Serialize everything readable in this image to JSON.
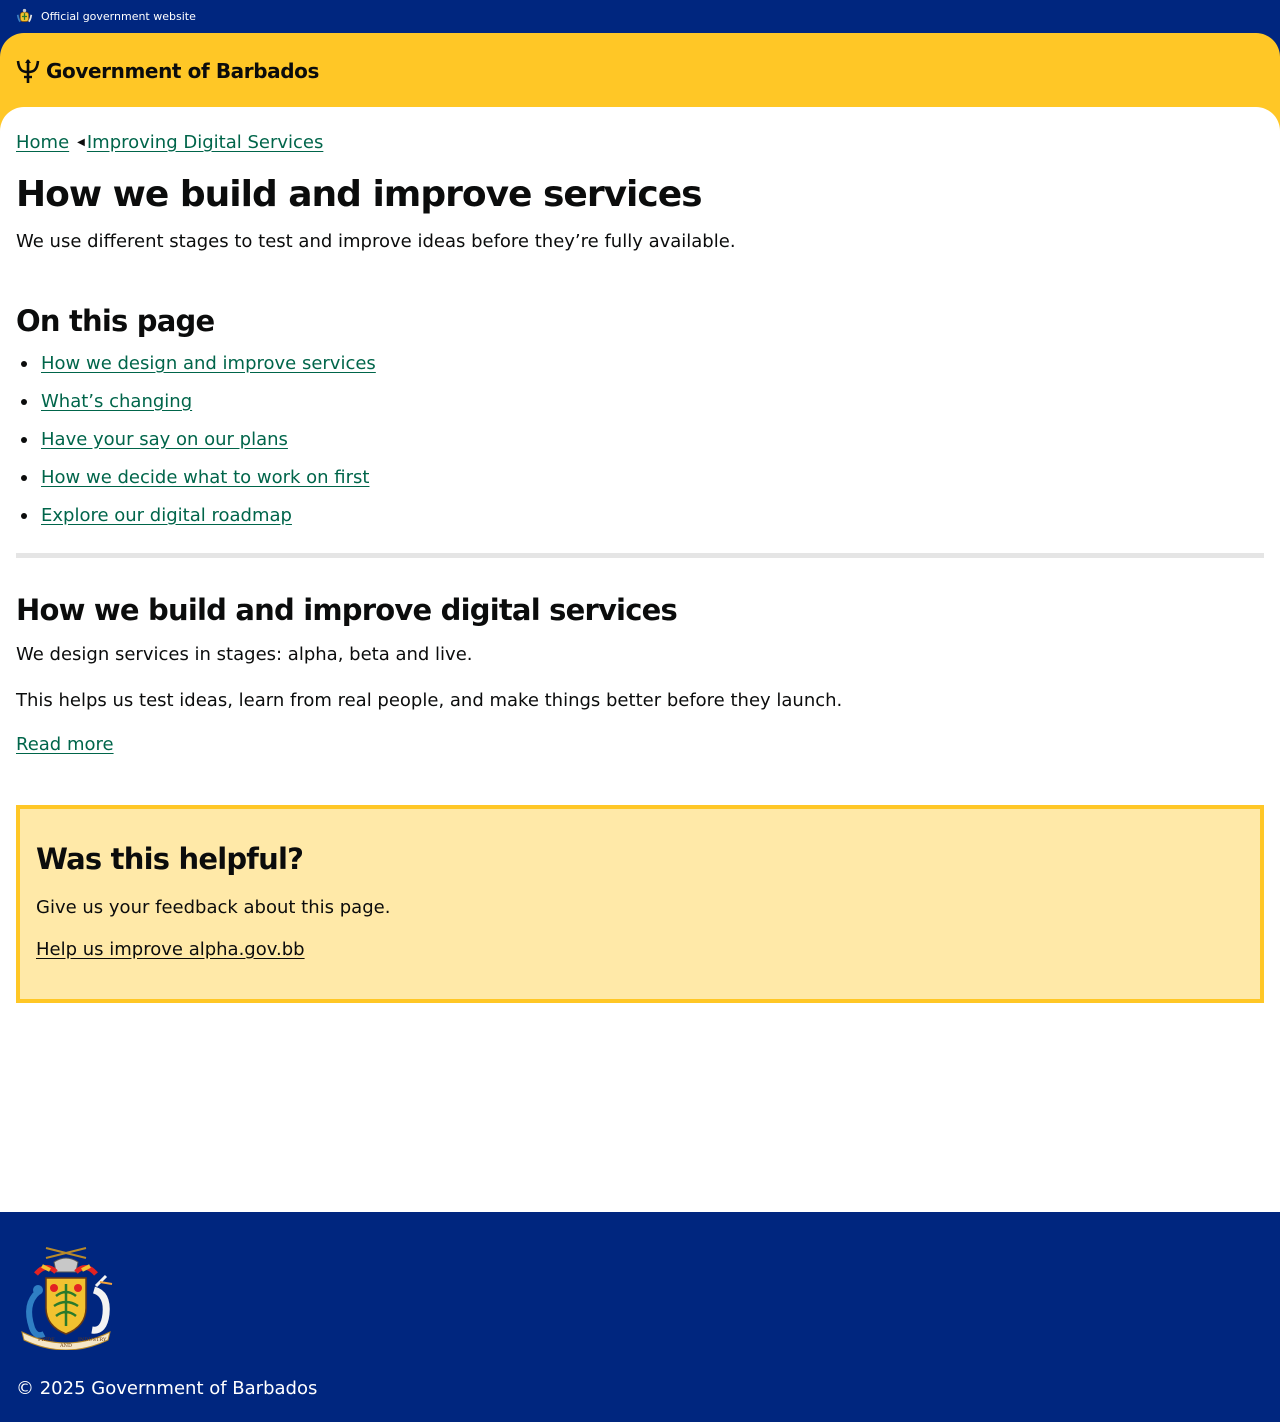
{
  "topbar": {
    "official_text": "Official government website",
    "crest_icon": "coat-of-arms-icon"
  },
  "header": {
    "brand_name": "Government of Barbados",
    "brand_icon": "trident-icon",
    "colors": {
      "banner": "#ffc726",
      "topbar": "#00267f"
    }
  },
  "breadcrumb": {
    "items": [
      {
        "label": "Home"
      },
      {
        "label": "Improving Digital Services"
      }
    ],
    "separator_icon": "arrow-left-icon"
  },
  "page": {
    "title": "How we build and improve services",
    "lead": "We use different stages to test and improve ideas before they’re fully available."
  },
  "toc": {
    "title": "On this page",
    "items": [
      {
        "label": "How we design and improve services"
      },
      {
        "label": "What’s changing"
      },
      {
        "label": "Have your say on our plans"
      },
      {
        "label": "How we decide what to work on first"
      },
      {
        "label": "Explore our digital roadmap"
      }
    ]
  },
  "section": {
    "title": "How we build and improve digital services",
    "paragraphs": [
      "We design services in stages: alpha, beta and live.",
      "This helps us test ideas, learn from real people, and make things better before they launch."
    ],
    "read_more": "Read more"
  },
  "feedback": {
    "title": "Was this helpful?",
    "text": "Give us your feedback about this page.",
    "link": "Help us improve alpha.gov.bb",
    "colors": {
      "border": "#ffc726",
      "background": "#ffe9a8"
    }
  },
  "footer": {
    "crest_icon": "coat-of-arms-icon",
    "crest_motto": [
      "PRIDE",
      "AND",
      "INDUSTRY"
    ],
    "copyright": "© 2025 Government of Barbados"
  },
  "link_color": "#00654a"
}
